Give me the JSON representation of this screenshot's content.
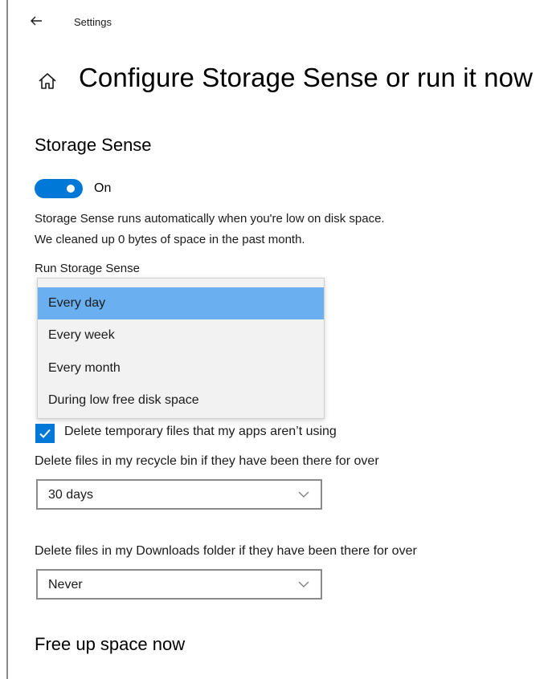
{
  "colors": {
    "accent": "#0078d7",
    "selected_option": "#6aaff0"
  },
  "header": {
    "back_icon": "arrow-left-icon",
    "app_title": "Settings"
  },
  "page": {
    "home_icon": "home-icon",
    "title": "Configure Storage Sense or run it now"
  },
  "storage_sense": {
    "title": "Storage Sense",
    "toggle": {
      "state": "on",
      "label": "On"
    },
    "description_line1": "Storage Sense runs automatically when you're low on disk space.",
    "description_line2": "We cleaned up 0 bytes of space in the past month.",
    "run_label": "Run Storage Sense",
    "run_options": [
      "Every day",
      "Every week",
      "Every month",
      "During low free disk space"
    ],
    "run_selected": "Every day"
  },
  "temp_files": {
    "checked": true,
    "label": "Delete temporary files that my apps aren’t using"
  },
  "recycle_bin": {
    "label": "Delete files in my recycle bin if they have been there for over",
    "value": "30 days"
  },
  "downloads": {
    "label": "Delete files in my Downloads folder if they have been there for over",
    "value": "Never"
  },
  "free_up": {
    "title": "Free up space now"
  }
}
